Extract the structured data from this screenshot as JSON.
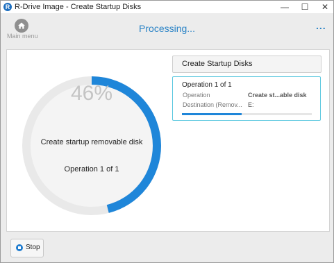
{
  "window": {
    "title": "R-Drive Image - Create Startup Disks",
    "app_icon": "R",
    "minimize": "—",
    "maximize": "☐",
    "close": "✕"
  },
  "header": {
    "main_menu_label": "Main menu",
    "status": "Processing...",
    "more": "..."
  },
  "progress": {
    "percent": 0.46,
    "percent_label": "46%",
    "description": "Create startup removable disk",
    "operation": "Operation 1 of 1"
  },
  "task": {
    "title": "Create Startup Disks"
  },
  "operation_card": {
    "title": "Operation 1 of 1",
    "rows": [
      {
        "label": "Operation",
        "value": "Create st...able disk"
      },
      {
        "label": "Destination (Remov...",
        "value": "E:"
      }
    ],
    "progress": 0.46
  },
  "footer": {
    "stop_label": "Stop"
  },
  "colors": {
    "accent": "#1f86d9",
    "track": "#e9e9e9",
    "card_border": "#5bc8df"
  }
}
